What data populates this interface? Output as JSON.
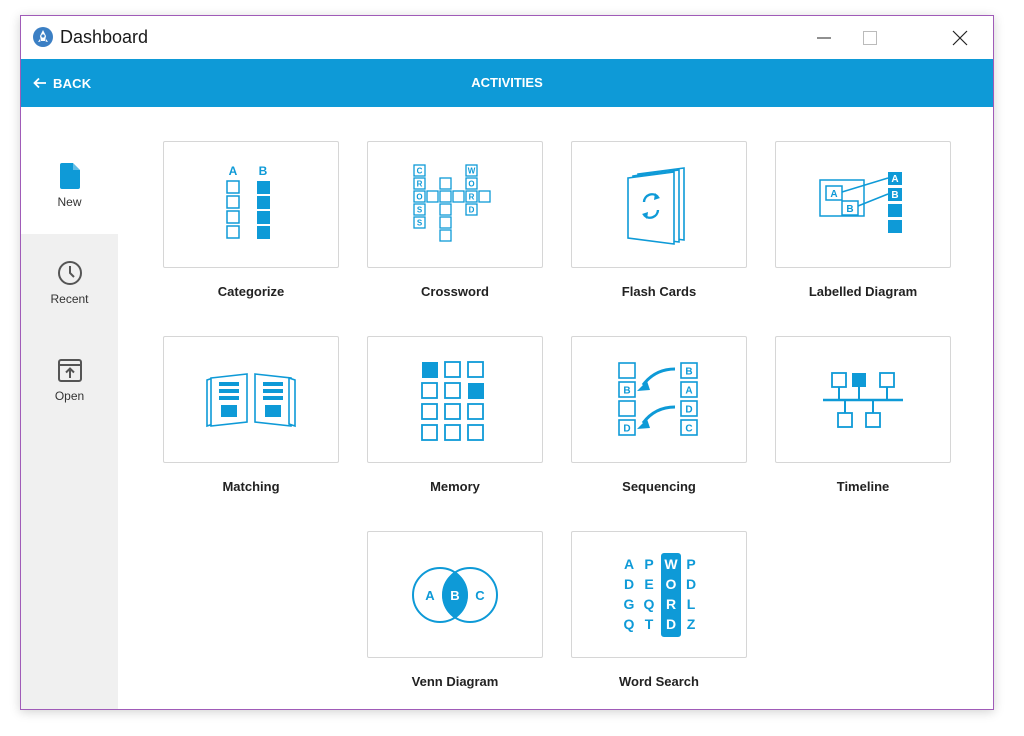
{
  "window": {
    "title": "Dashboard"
  },
  "toolbar": {
    "back_label": "BACK",
    "title": "ACTIVITIES"
  },
  "sidebar": {
    "items": [
      {
        "label": "New",
        "icon": "new-document-icon",
        "active": true
      },
      {
        "label": "Recent",
        "icon": "clock-icon",
        "active": false
      },
      {
        "label": "Open",
        "icon": "open-folder-icon",
        "active": false
      }
    ]
  },
  "activities": [
    {
      "label": "Categorize",
      "icon": "categorize-icon"
    },
    {
      "label": "Crossword",
      "icon": "crossword-icon"
    },
    {
      "label": "Flash Cards",
      "icon": "flash-cards-icon"
    },
    {
      "label": "Labelled Diagram",
      "icon": "labelled-diagram-icon"
    },
    {
      "label": "Matching",
      "icon": "matching-icon"
    },
    {
      "label": "Memory",
      "icon": "memory-icon"
    },
    {
      "label": "Sequencing",
      "icon": "sequencing-icon"
    },
    {
      "label": "Timeline",
      "icon": "timeline-icon"
    },
    {
      "label": "Venn Diagram",
      "icon": "venn-diagram-icon"
    },
    {
      "label": "Word Search",
      "icon": "word-search-icon"
    }
  ],
  "icon_text": {
    "categorize": [
      "A",
      "B"
    ],
    "crossword_left": [
      "C",
      "R",
      "O",
      "S",
      "S"
    ],
    "crossword_right": [
      "W",
      "O",
      "R",
      "D"
    ],
    "labelled": [
      "A",
      "B",
      "A",
      "B"
    ],
    "sequencing": [
      "B",
      "D",
      "B",
      "A",
      "D",
      "C"
    ],
    "venn": [
      "A",
      "B",
      "C"
    ],
    "wordsearch": [
      [
        "A",
        "P",
        "W",
        "P"
      ],
      [
        "D",
        "E",
        "O",
        "D"
      ],
      [
        "G",
        "Q",
        "R",
        "L"
      ],
      [
        "Q",
        "T",
        "D",
        "Z"
      ]
    ]
  },
  "colors": {
    "accent": "#0e9ad7",
    "window_border": "#a05bb8",
    "sidebar_bg": "#f0f0f0"
  }
}
